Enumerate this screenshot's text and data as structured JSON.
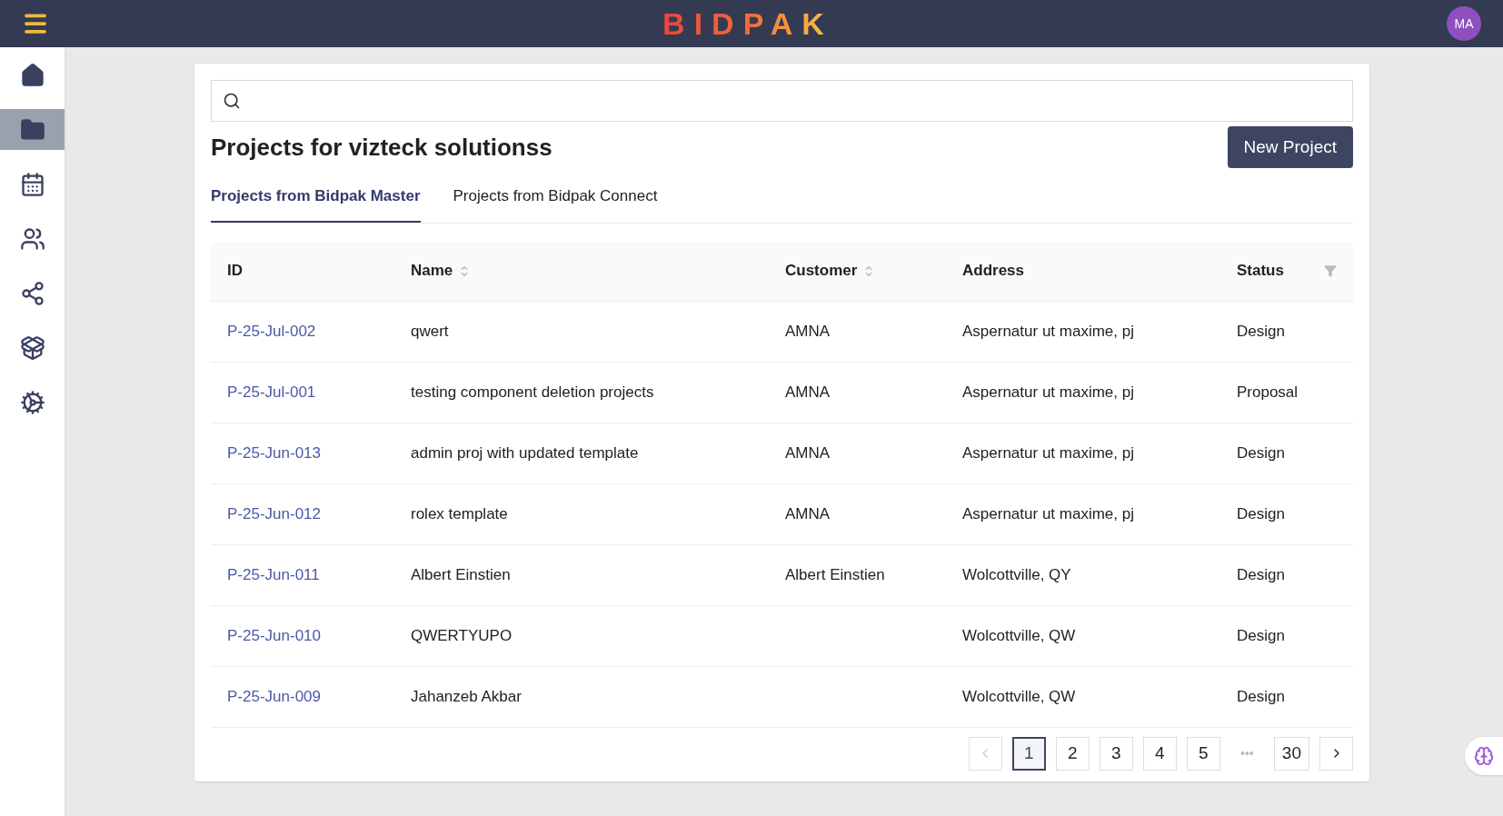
{
  "topbar": {
    "logo": "BIDPAK",
    "avatar": "MA"
  },
  "sidebar": {
    "items": [
      {
        "kind": "home",
        "selected": false
      },
      {
        "kind": "projects",
        "selected": true
      },
      {
        "kind": "calendar",
        "selected": false
      },
      {
        "kind": "team",
        "selected": false
      },
      {
        "kind": "network",
        "selected": false
      },
      {
        "kind": "products",
        "selected": false
      },
      {
        "kind": "settings",
        "selected": false
      }
    ]
  },
  "title": "Projects for vizteck solutionss",
  "new_button": "New Project",
  "tabs": [
    {
      "label": "Projects from Bidpak Master",
      "selected": true
    },
    {
      "label": "Projects from Bidpak Connect",
      "selected": false
    }
  ],
  "table": {
    "columns": [
      {
        "label": "ID",
        "sort": false,
        "filter": false
      },
      {
        "label": "Name",
        "sort": true,
        "filter": false
      },
      {
        "label": "Customer",
        "sort": true,
        "filter": false
      },
      {
        "label": "Address",
        "sort": false,
        "filter": false
      },
      {
        "label": "Status",
        "sort": false,
        "filter": true
      }
    ],
    "rows": [
      [
        "P-25-Jul-002",
        "qwert",
        "AMNA",
        "Aspernatur ut maxime, pj",
        "Design"
      ],
      [
        "P-25-Jul-001",
        "testing component deletion projects",
        "AMNA",
        "Aspernatur ut maxime, pj",
        "Proposal"
      ],
      [
        "P-25-Jun-013",
        "admin proj with updated template",
        "AMNA",
        "Aspernatur ut maxime, pj",
        "Design"
      ],
      [
        "P-25-Jun-012",
        "rolex template",
        "AMNA",
        "Aspernatur ut maxime, pj",
        "Design"
      ],
      [
        "P-25-Jun-011",
        "Albert Einstien",
        "Albert Einstien",
        "Wolcottville, QY",
        "Design"
      ],
      [
        "P-25-Jun-010",
        "QWERTYUPO",
        "",
        "Wolcottville, QW",
        "Design"
      ],
      [
        "P-25-Jun-009",
        "Jahanzeb Akbar",
        "",
        "Wolcottville, QW",
        "Design"
      ]
    ]
  },
  "pagination": {
    "prev_disabled": true,
    "next_disabled": false,
    "pages": [
      {
        "label": "1",
        "selected": true
      },
      {
        "label": "2",
        "selected": false
      },
      {
        "label": "3",
        "selected": false
      },
      {
        "label": "4",
        "selected": false
      },
      {
        "label": "5",
        "selected": false
      },
      {
        "label": "•••",
        "kind": "ellipsis"
      },
      {
        "label": "30",
        "selected": false
      }
    ]
  }
}
